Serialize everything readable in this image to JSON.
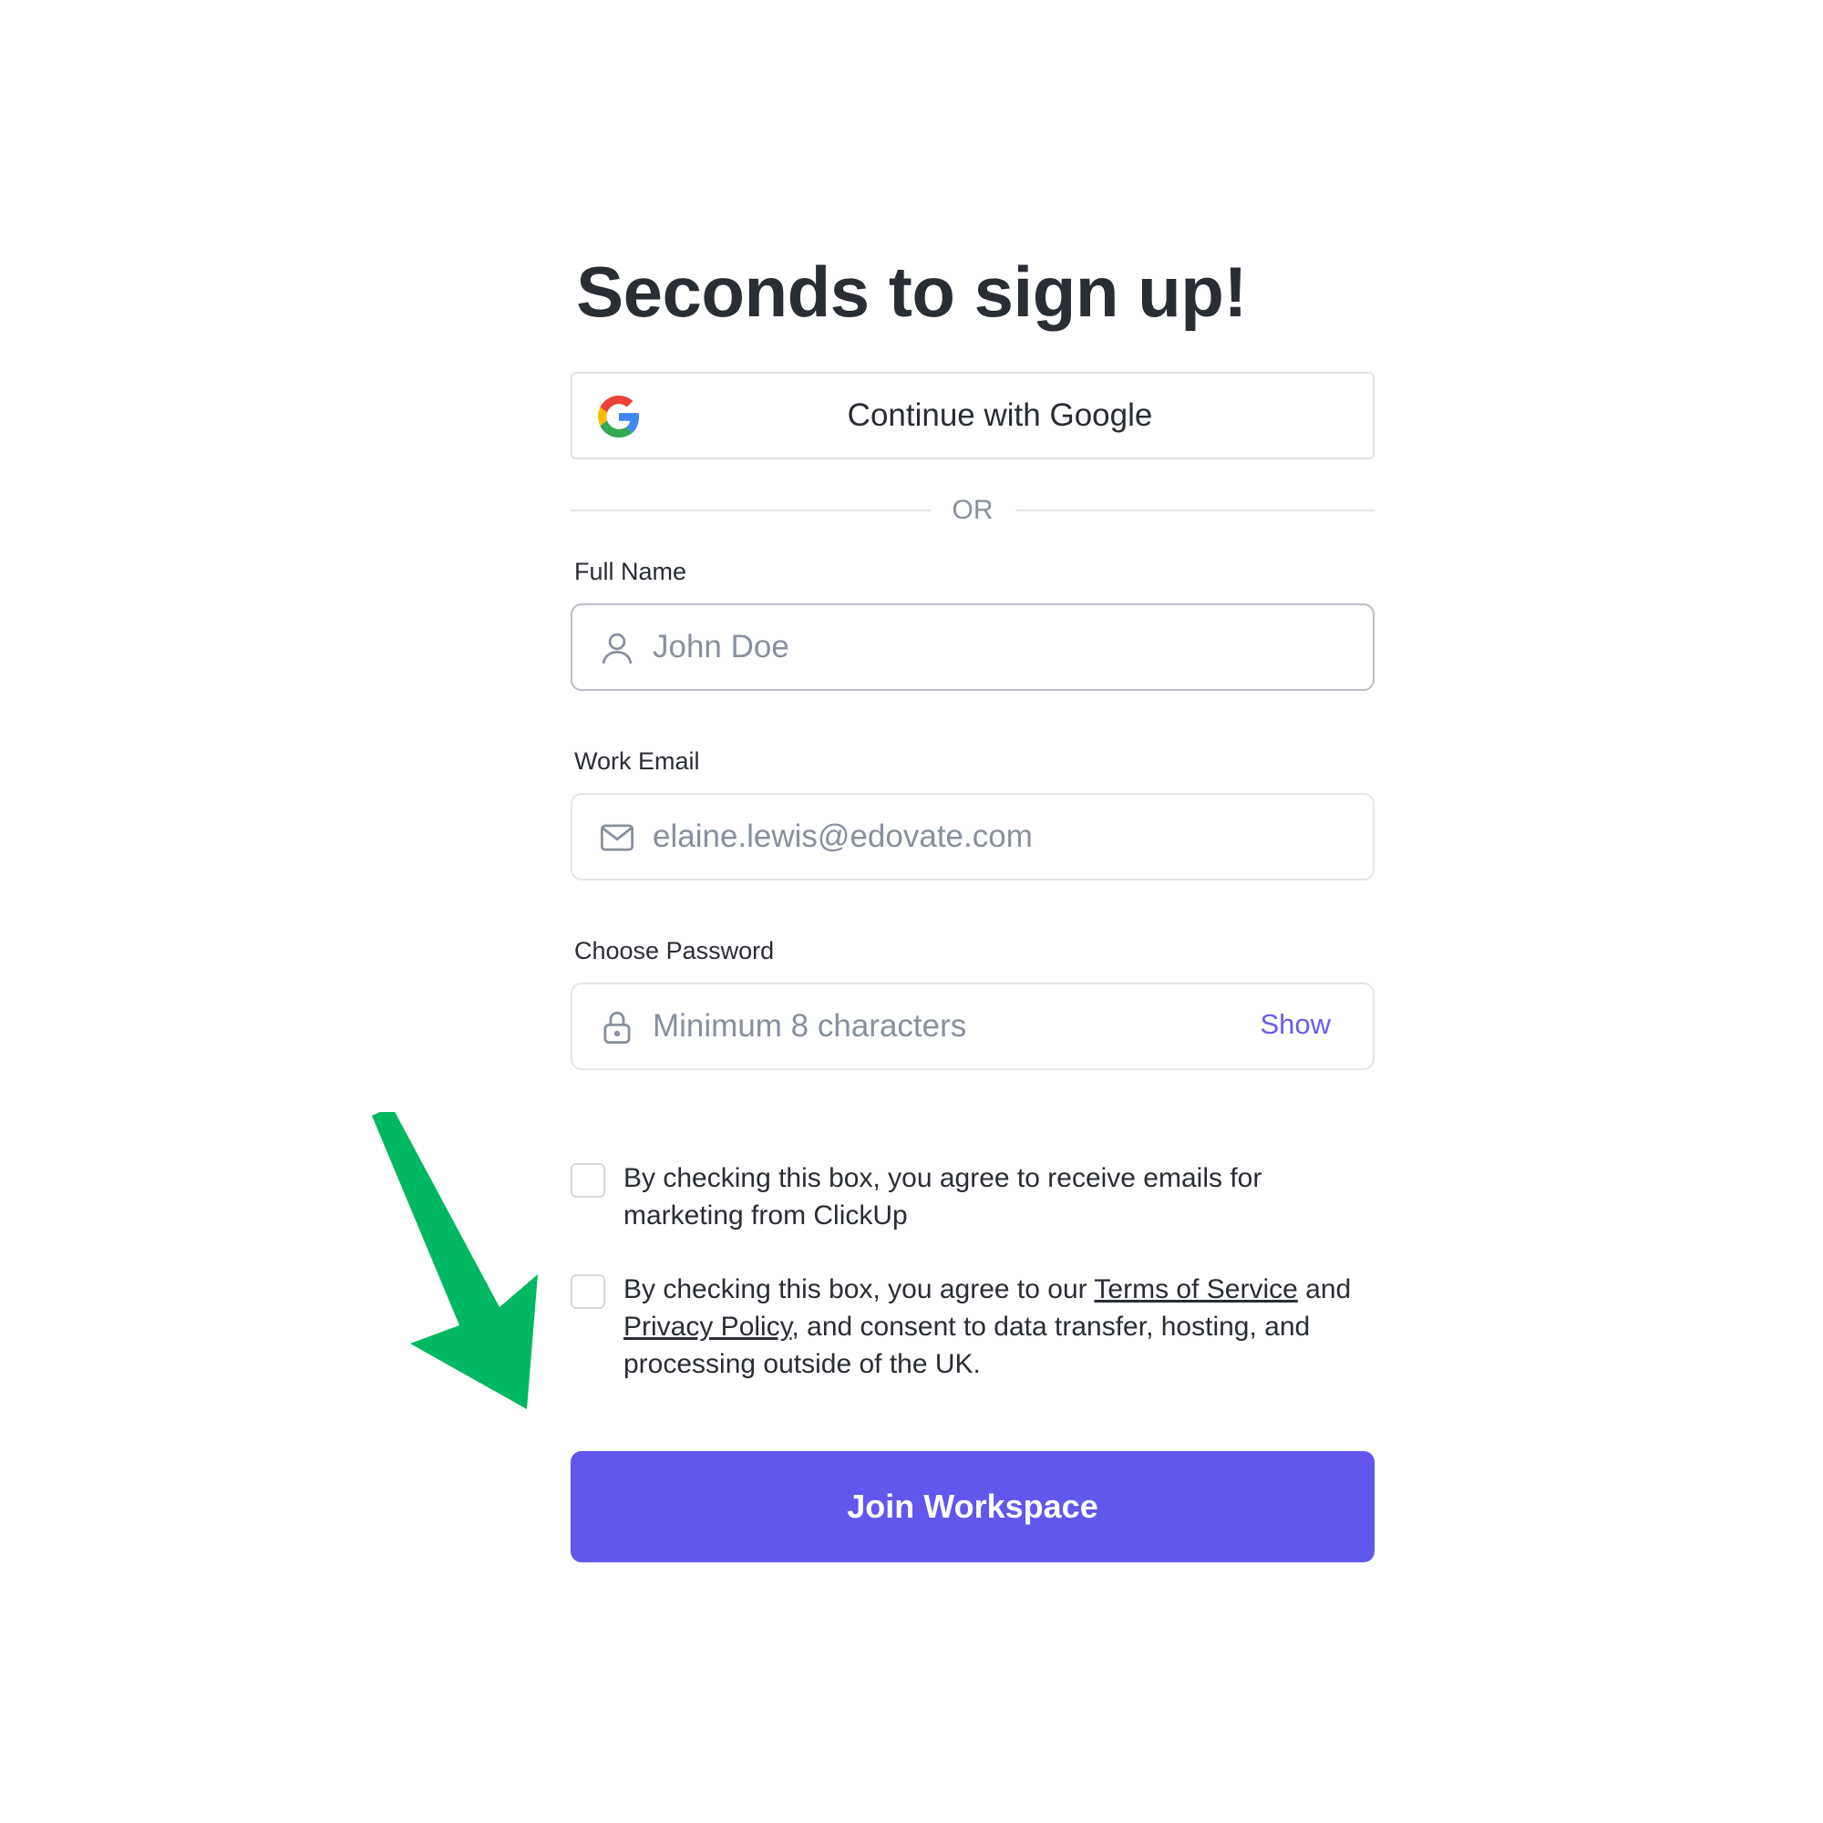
{
  "title": "Seconds to sign up!",
  "google_button": {
    "label": "Continue with Google",
    "icon": "google-logo-icon"
  },
  "divider_text": "OR",
  "full_name": {
    "label": "Full Name",
    "placeholder": "John Doe",
    "icon": "user-icon"
  },
  "work_email": {
    "label": "Work Email",
    "placeholder": "elaine.lewis@edovate.com",
    "icon": "mail-icon"
  },
  "password": {
    "label": "Choose Password",
    "placeholder": "Minimum 8 characters",
    "icon": "lock-icon",
    "toggle_label": "Show"
  },
  "marketing_checkbox": {
    "text": "By checking this box, you agree to receive emails for marketing from ClickUp"
  },
  "terms_checkbox": {
    "prefix": "By checking this box, you agree to our ",
    "terms_link": "Terms of Service",
    "middle": " and ",
    "privacy_link": "Privacy Policy",
    "suffix": ", and consent to data transfer, hosting, and processing outside of the UK."
  },
  "submit_button": {
    "label": "Join Workspace"
  },
  "colors": {
    "accent": "#6157ed",
    "link_accent": "#6b5bed",
    "annotation_arrow": "#00b862",
    "text": "#292d34",
    "placeholder": "#87909e"
  },
  "annotation": {
    "icon": "green-arrow-pointer-icon"
  }
}
